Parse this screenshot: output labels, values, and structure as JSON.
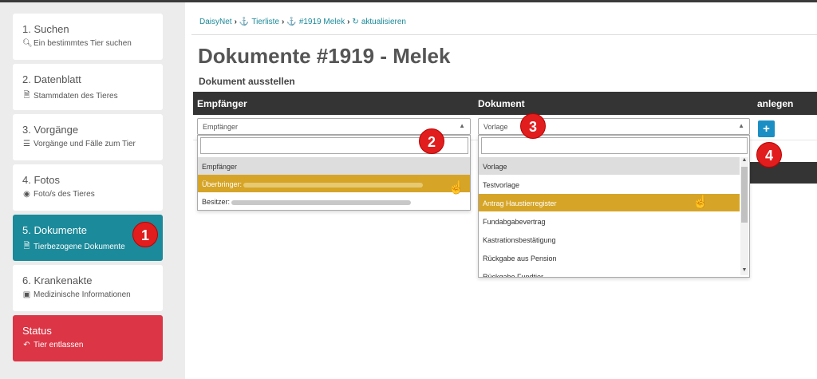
{
  "sidebar": {
    "items": [
      {
        "title": "1. Suchen",
        "sub": "Ein bestimmtes Tier suchen",
        "icon": "search-icon"
      },
      {
        "title": "2. Datenblatt",
        "sub": "Stammdaten des Tieres",
        "icon": "document-icon"
      },
      {
        "title": "3. Vorgänge",
        "sub": "Vorgänge und Fälle zum Tier",
        "icon": "list-icon"
      },
      {
        "title": "4. Fotos",
        "sub": "Foto/s des Tieres",
        "icon": "camera-icon"
      },
      {
        "title": "5. Dokumente",
        "sub": "Tierbezogene Dokumente",
        "icon": "document-icon"
      },
      {
        "title": "6. Krankenakte",
        "sub": "Medizinische Informationen",
        "icon": "laptop-icon"
      },
      {
        "title": "Status",
        "sub": "Tier entlassen",
        "icon": "reply-icon"
      }
    ],
    "active_color": "#1b8a9a",
    "status_color": "#dc3545"
  },
  "breadcrumb": {
    "home": "DaisyNet",
    "list": "Tierliste",
    "animal": "#1919 Melek",
    "refresh": "aktualisieren"
  },
  "page": {
    "title": "Dokumente #1919 - Melek",
    "section": "Dokument ausstellen"
  },
  "table": {
    "headers": [
      "Empfänger",
      "Dokument",
      "anlegen"
    ]
  },
  "recipient": {
    "selected": "Empfänger",
    "options": [
      {
        "label": "Empfänger"
      },
      {
        "label": "Überbringer:"
      },
      {
        "label": "Besitzer:"
      }
    ]
  },
  "document": {
    "selected": "Vorlage",
    "options": [
      {
        "label": "Vorlage"
      },
      {
        "label": "Testvorlage"
      },
      {
        "label": "Antrag Haustierregister"
      },
      {
        "label": "Fundabgabevertrag"
      },
      {
        "label": "Kastrationsbestätigung"
      },
      {
        "label": "Rückgabe aus Pension"
      },
      {
        "label": "Rückgabe Fundtier"
      }
    ]
  },
  "add_button": "+",
  "badges": [
    "1",
    "2",
    "3",
    "4"
  ],
  "colors": {
    "highlight": "#d6a527",
    "header_bg": "#343434",
    "add_button": "#1b8fc4",
    "badge": "#e11d1d"
  }
}
